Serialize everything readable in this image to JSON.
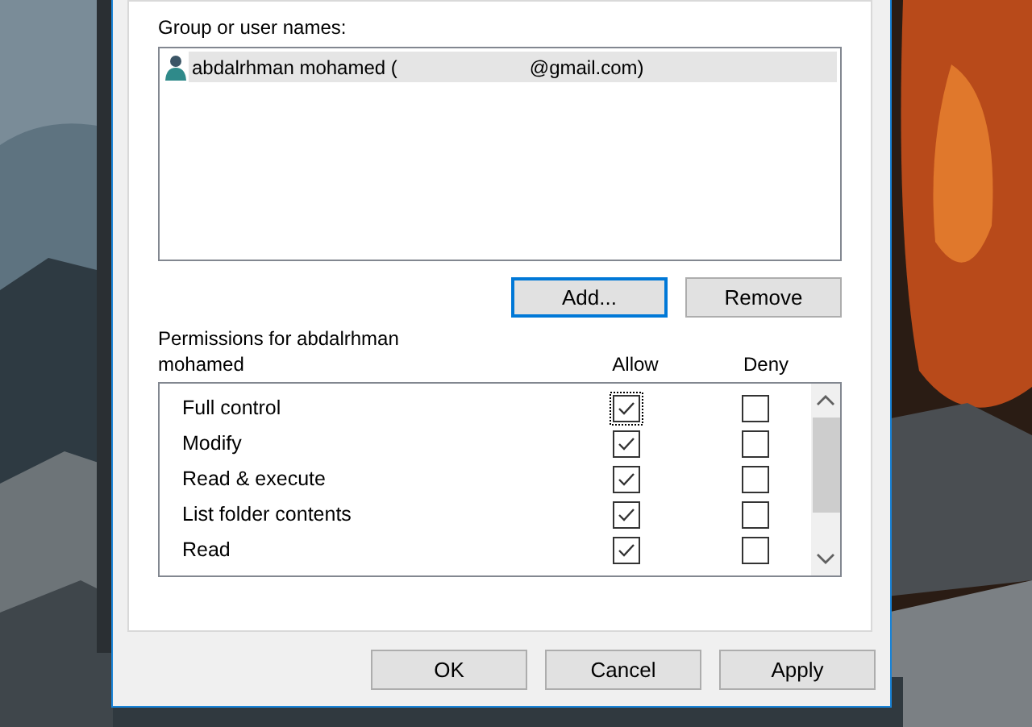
{
  "group_label": "Group or user names:",
  "users": [
    {
      "name": "abdalrhman mohamed (",
      "email": "@gmail.com)",
      "selected": true
    }
  ],
  "user_buttons": [
    {
      "label": "Add...",
      "focused": true
    },
    {
      "label": "Remove",
      "focused": false
    }
  ],
  "permissions_label": "Permissions for abdalrhman mohamed",
  "columns": [
    "Allow",
    "Deny"
  ],
  "permissions": [
    {
      "label": "Full control",
      "allow": true,
      "deny": false,
      "focused": true
    },
    {
      "label": "Modify",
      "allow": true,
      "deny": false,
      "focused": false
    },
    {
      "label": "Read & execute",
      "allow": true,
      "deny": false,
      "focused": false
    },
    {
      "label": "List folder contents",
      "allow": true,
      "deny": false,
      "focused": false
    },
    {
      "label": "Read",
      "allow": true,
      "deny": false,
      "focused": false
    }
  ],
  "dialog_buttons": [
    "OK",
    "Cancel",
    "Apply"
  ]
}
